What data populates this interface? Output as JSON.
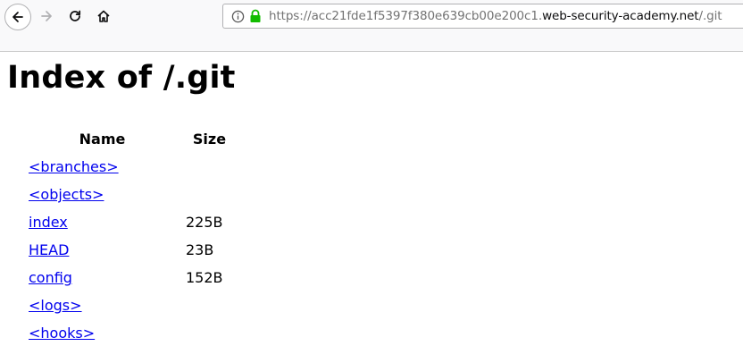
{
  "browser": {
    "url_prefix": "https://acc21fde1f5397f380e639cb00e200c1.",
    "url_host": "web-security-academy.net",
    "url_path": "/.git"
  },
  "page": {
    "title": "Index of /.git",
    "columns": {
      "name": "Name",
      "size": "Size"
    },
    "entries": [
      {
        "name": "<branches>",
        "size": ""
      },
      {
        "name": "<objects>",
        "size": ""
      },
      {
        "name": "index",
        "size": "225B"
      },
      {
        "name": "HEAD",
        "size": "23B"
      },
      {
        "name": "config",
        "size": "152B"
      },
      {
        "name": "<logs>",
        "size": ""
      },
      {
        "name": "<hooks>",
        "size": ""
      }
    ]
  },
  "colors": {
    "link": "#0000ee",
    "lock": "#12bc00",
    "toolbar_bg": "#f9f9fa"
  }
}
